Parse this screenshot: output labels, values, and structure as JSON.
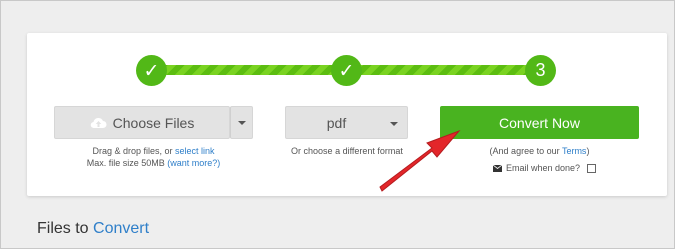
{
  "steps": {
    "step1_icon": "check-icon",
    "step2_icon": "check-icon",
    "step3_label": "3"
  },
  "choose": {
    "label": "Choose Files",
    "icon": "cloud-upload-icon",
    "hint_text": "Drag & drop files, or ",
    "hint_link": "select link",
    "size_text": "Max. file size 50MB ",
    "size_link": "(want more?)"
  },
  "format": {
    "selected": "pdf",
    "hint": "Or choose a different format"
  },
  "convert": {
    "label": "Convert Now",
    "agree_text": "(And agree to our ",
    "agree_link": "Terms",
    "agree_close": ")",
    "email_label": "Email when done?"
  },
  "heading": {
    "prefix": "Files to ",
    "accent": "Convert"
  },
  "colors": {
    "accent_green": "#49b320",
    "link_blue": "#2f7fc9",
    "arrow_red": "#e3262a"
  }
}
